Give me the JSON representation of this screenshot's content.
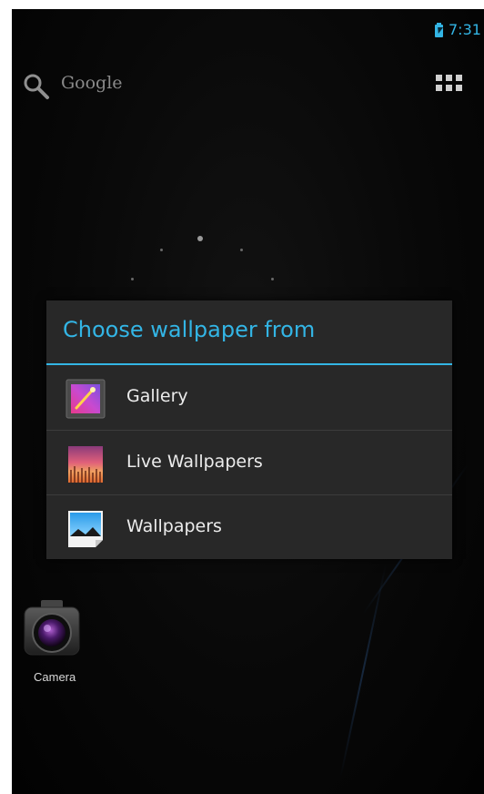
{
  "status_bar": {
    "time": "7:31",
    "battery_icon": "battery-charging-icon",
    "accent_color": "#33b5e5"
  },
  "home": {
    "search_label": "Google",
    "search_icon": "search-icon",
    "apps_icon": "app-drawer-icon"
  },
  "dialog": {
    "title": "Choose wallpaper from",
    "options": [
      {
        "label": "Gallery",
        "icon": "gallery-icon"
      },
      {
        "label": "Live Wallpapers",
        "icon": "live-wallpapers-icon"
      },
      {
        "label": "Wallpapers",
        "icon": "wallpapers-icon"
      }
    ]
  },
  "dock": {
    "camera_label": "Camera",
    "camera_icon": "camera-icon"
  }
}
